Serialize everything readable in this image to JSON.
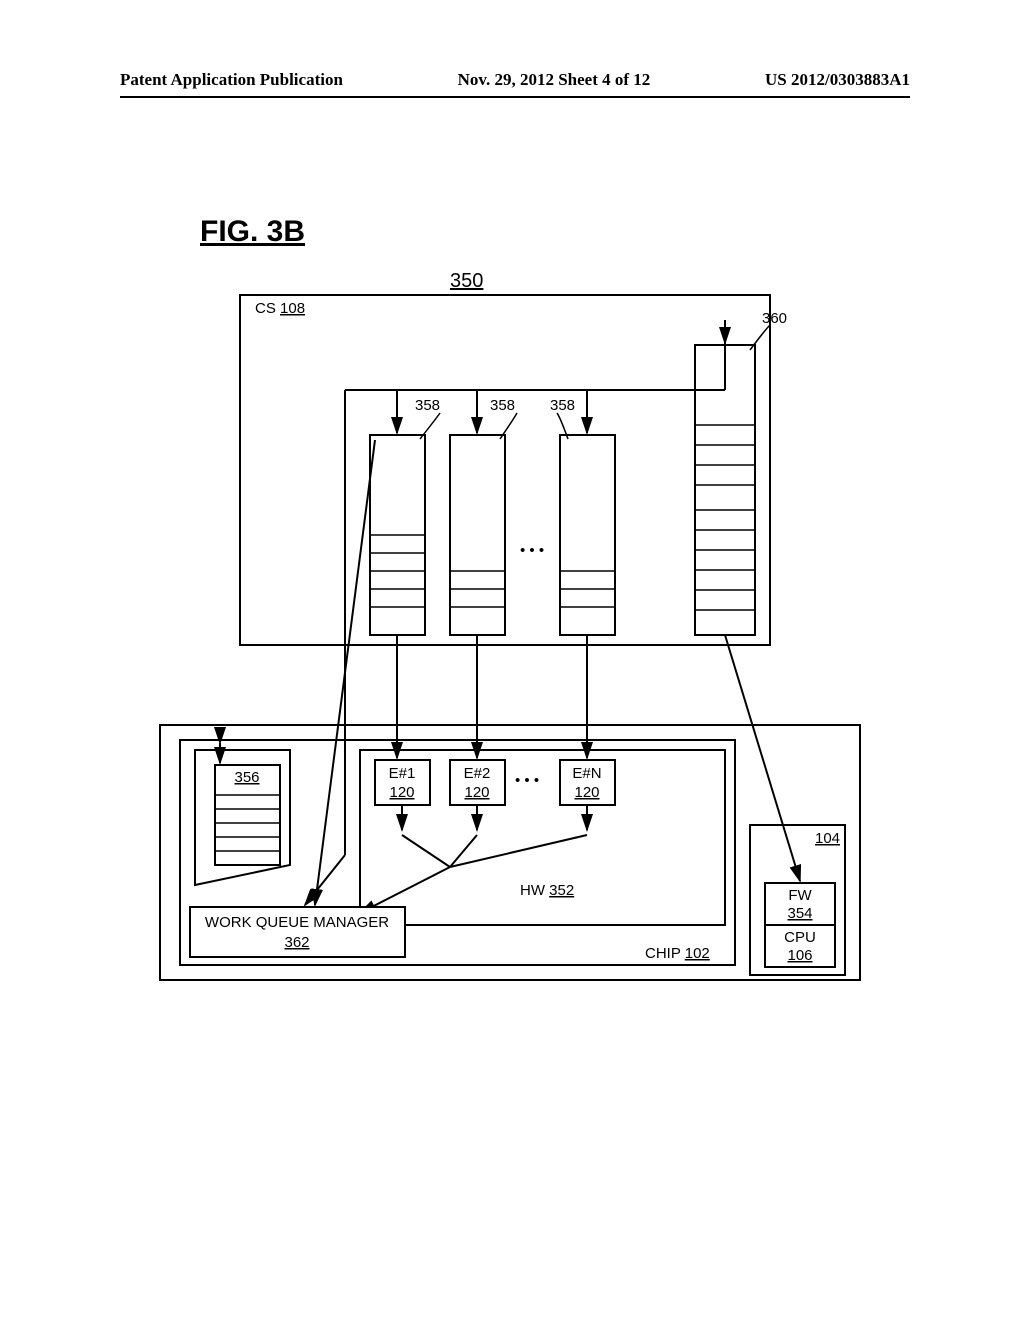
{
  "header": {
    "left": "Patent Application Publication",
    "center": "Nov. 29, 2012  Sheet 4 of 12",
    "right": "US 2012/0303883A1"
  },
  "figure": {
    "title": "FIG. 3B",
    "ref350": "350"
  },
  "cs_box": {
    "label_prefix": "CS ",
    "label_ref": "108"
  },
  "queues": {
    "ref358_1": "358",
    "ref358_2": "358",
    "ref358_3": "358",
    "ref360": "360",
    "dots": "• • •"
  },
  "engines": {
    "e1_top": "E#1",
    "e1_ref": "120",
    "e2_top": "E#2",
    "e2_ref": "120",
    "en_top": "E#N",
    "en_ref": "120",
    "dots": "• • •"
  },
  "small_queue": {
    "ref": "356"
  },
  "wqm": {
    "line1": "WORK QUEUE MANAGER",
    "line2": "362"
  },
  "hw": {
    "label": "HW ",
    "ref": "352"
  },
  "chip": {
    "label": "CHIP ",
    "ref": "102"
  },
  "right_box": {
    "ref104": "104",
    "fw": "FW",
    "fw_ref": "354",
    "cpu": "CPU",
    "cpu_ref": "106"
  }
}
